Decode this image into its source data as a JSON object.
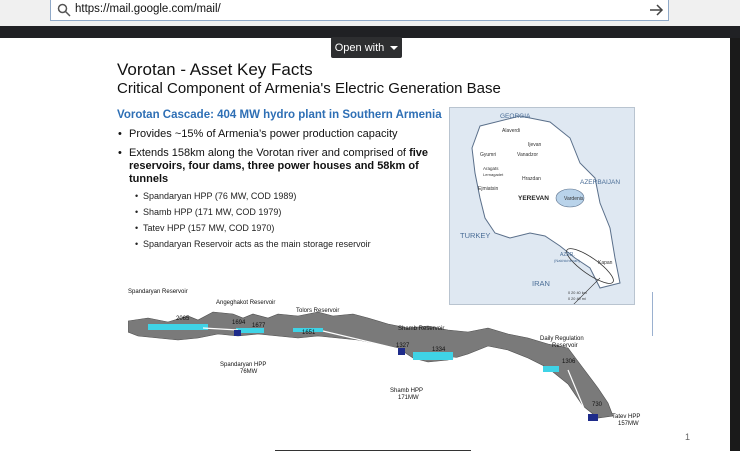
{
  "browser": {
    "url": "https://mail.google.com/mail/"
  },
  "viewer": {
    "open_with_label": "Open with"
  },
  "slide": {
    "title_line1": "Vorotan - Asset Key Facts",
    "title_line2": "Critical Component of Armenia's Electric Generation Base",
    "subheading": "Vorotan Cascade: 404 MW hydro plant in Southern Armenia",
    "bullets": [
      "Provides ~15% of Armenia’s power production capacity",
      "Extends 158km along the Vorotan river and comprised of",
      "five",
      "reservoirs, four dams, three power houses and 58km of",
      "tunnels"
    ],
    "sub_bullets": [
      "Spandaryan HPP (76 MW, COD 1989)",
      "Shamb HPP (171 MW, COD 1979)",
      "Tatev HPP (157 MW, COD 1970)",
      "Spandaryan Reservoir acts as the main storage reservoir"
    ],
    "page_number": "1"
  },
  "map": {
    "labels": {
      "georgia": "GEORGIA",
      "alaverdi": "Alaverdi",
      "ijevan": "Ijevan",
      "gyumri": "Gyumri",
      "vanadzor": "Vanadzor",
      "aragats": "Aragats",
      "lerma": "Lernagadet",
      "hrazdan": "Hrazdan",
      "ejmiatsin": "Ejmiatsin",
      "yerevan": "YEREVAN",
      "vardenis": "Vardenis",
      "azerbaijan": "AZERBAIJAN",
      "turkey": "TURKEY",
      "azer": "AZER.",
      "nakhichevan": "(Nakhichevan)",
      "kapan": "Kapan",
      "iran": "IRAN",
      "scale": "0   20   40 km",
      "scale_mi": "0   20   40 mi"
    }
  },
  "profile": {
    "labels": {
      "spandaryan_reservoir": "Spandaryan Reservoir",
      "angeghakot_reservoir": "Angeghakot  Reservoir",
      "tolors_reservoir": "Tolors Reservoir",
      "shamb_reservoir": "Shamb Reservoir",
      "daily_reg_1": "Daily Regulation",
      "daily_reg_2": "Reservoir",
      "spandaryan_hpp_1": "Spandaryan HPP",
      "spandaryan_hpp_2": "76MW",
      "shamb_hpp_1": "Shamb HPP",
      "shamb_hpp_2": "171MW",
      "tatev_hpp_1": "Tatev HPP",
      "tatev_hpp_2": "157MW"
    },
    "elevations": {
      "e2065": "2065",
      "e1694": "1694",
      "e1677": "1677",
      "e1651": "1651",
      "e1327": "1327",
      "e1334": "1334",
      "e1306": "1306",
      "e730": "730"
    }
  },
  "colors": {
    "subheading": "#2e6fb5",
    "water": "#3fd3e6",
    "terrain": "#7a7a7a"
  }
}
